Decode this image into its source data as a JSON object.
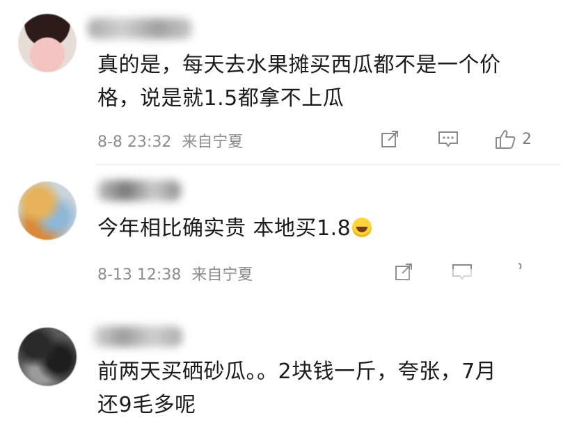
{
  "comments": [
    {
      "text_line1": "真的是，每天去水果摊买西瓜都不是一个价",
      "text_line2": "格，说是就1.5都拿不上瓜",
      "timestamp": "8-8 23:32",
      "location": "来自宁夏",
      "like_count": "2"
    },
    {
      "text_line1": "今年相比确实贵 本地买1.8",
      "timestamp": "8-13 12:38",
      "location": "来自宁夏"
    },
    {
      "text_line1": "前两天买硒砂瓜。。2块钱一斤，夸张，7月",
      "text_line2": "还9毛多呢"
    }
  ],
  "icons": {
    "share": "share-icon",
    "reply": "comment-icon",
    "like": "thumbs-up-icon",
    "emoji": "laughing-crying-emoji"
  }
}
